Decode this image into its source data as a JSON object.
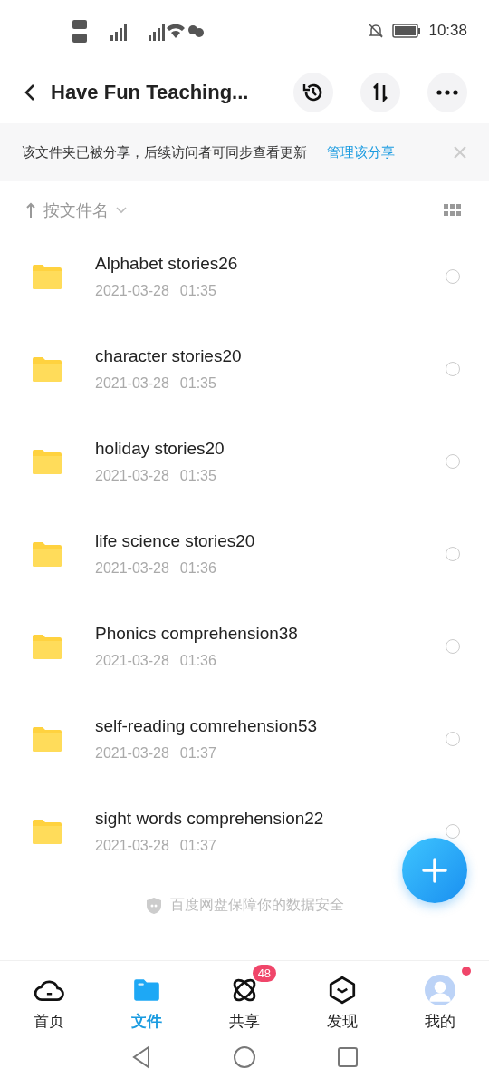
{
  "status_bar": {
    "time": "10:38"
  },
  "header": {
    "title": "Have Fun Teaching..."
  },
  "banner": {
    "text": "该文件夹已被分享，后续访问者可同步查看更新",
    "link": "管理该分享"
  },
  "sort": {
    "label": "按文件名"
  },
  "files": [
    {
      "name": "Alphabet stories26",
      "date": "2021-03-28",
      "time": "01:35",
      "selected": false
    },
    {
      "name": "character stories20",
      "date": "2021-03-28",
      "time": "01:35",
      "selected": false
    },
    {
      "name": "holiday stories20",
      "date": "2021-03-28",
      "time": "01:35",
      "selected": false
    },
    {
      "name": "life science stories20",
      "date": "2021-03-28",
      "time": "01:36",
      "selected": false
    },
    {
      "name": "Phonics comprehension38",
      "date": "2021-03-28",
      "time": "01:36",
      "selected": false
    },
    {
      "name": "self-reading comrehension53",
      "date": "2021-03-28",
      "time": "01:37",
      "selected": false
    },
    {
      "name": "sight words comprehension22",
      "date": "2021-03-28",
      "time": "01:37",
      "selected": false
    }
  ],
  "footer_note": "百度网盘保障你的数据安全",
  "tabs": [
    {
      "label": "首页",
      "selected": false,
      "dot": false
    },
    {
      "label": "文件",
      "selected": true,
      "dot": false
    },
    {
      "label": "共享",
      "selected": false,
      "badge": "48",
      "dot": false
    },
    {
      "label": "发现",
      "selected": false,
      "dot": false
    },
    {
      "label": "我的",
      "selected": false,
      "dot": true
    }
  ]
}
